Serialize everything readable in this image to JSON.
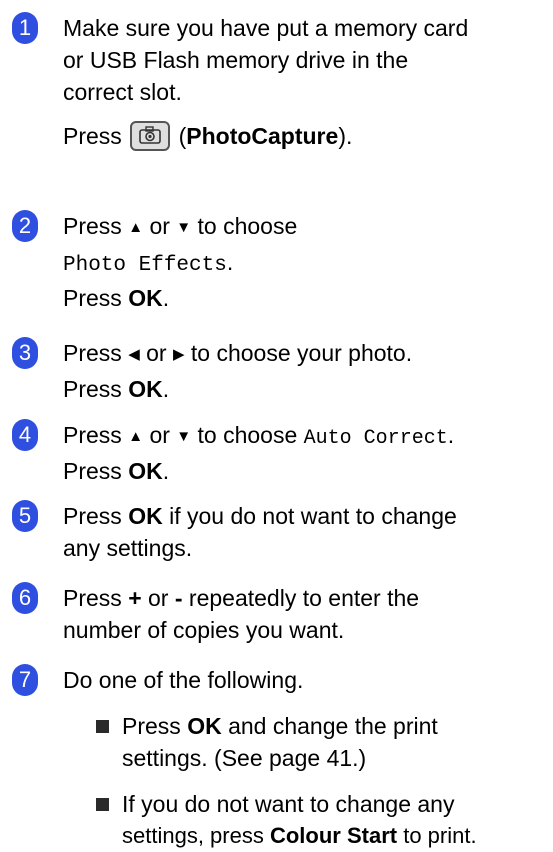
{
  "steps": [
    {
      "num": "1",
      "l1": "Make sure you have put a memory card",
      "l2": "or USB Flash memory drive in the",
      "l3": "correct slot.",
      "press": "Press",
      "button": "PhotoCapture",
      "open": "(",
      "close": ")."
    },
    {
      "num": "2",
      "press": "Press",
      "up": "▲",
      "or": "or",
      "down": "▼",
      "choose": "to choose",
      "menu": "Photo Effects",
      "dot": ".",
      "press2": "Press",
      "ok": "OK",
      "dot2": "."
    },
    {
      "num": "3",
      "press": "Press",
      "left": "◀",
      "or": "or",
      "right": "▶",
      "choose": "to choose your photo.",
      "press2": "Press",
      "ok": "OK",
      "dot2": "."
    },
    {
      "num": "4",
      "press": "Press",
      "up": "▲",
      "or": "or",
      "down": "▼",
      "choose": "to choose",
      "menu": "Auto Correct",
      "dot": ".",
      "press2": "Press",
      "ok": "OK",
      "dot2": "."
    },
    {
      "num": "5",
      "press": "Press",
      "ok": "OK",
      "rest": "if you do not want to change",
      "l2": "any settings."
    },
    {
      "num": "6",
      "press": "Press",
      "plus": "+",
      "or": "or",
      "minus": "-",
      "rest": "repeatedly to enter the",
      "l2": "number of copies you want."
    },
    {
      "num": "7",
      "l1": "Do one of the following."
    }
  ],
  "bullets": [
    {
      "press": "Press",
      "ok": "OK",
      "rest": "and change the print",
      "l2": "settings. (See page 41.)"
    },
    {
      "l1": "If you do not want to change any",
      "l2a": "settings, press",
      "bold": "Colour Start",
      "l2b": "to print."
    }
  ],
  "colors": {
    "step_number_bg": "#2e4fe0",
    "bullet": "#2a2a2a"
  }
}
